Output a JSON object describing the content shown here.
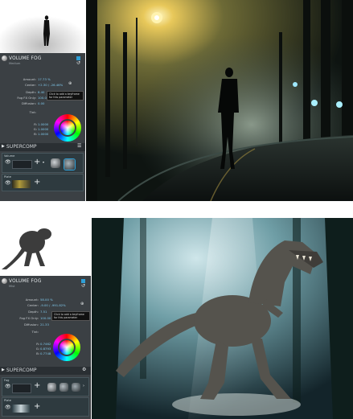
{
  "panel_top": {
    "plugin_title": "VOLUME FOG",
    "preset_label": "Medium",
    "amount_label": "Amount:",
    "amount_value": "17.73 %",
    "center_label": "Center:",
    "center_value": "+2.30 / -26.46%",
    "depth_label": "Depth:",
    "depth_value": "8.40",
    "fogfx_label": "Fog FX Only:",
    "fogfx_value": "100.0",
    "diffusion_label": "Diffusion:",
    "diffusion_value": "0.00",
    "tint_label": "Tint:",
    "tooltip": "Click to add a keyframe for this parameter",
    "r_label": "R:",
    "r_value": "1.0000",
    "g_label": "G:",
    "g_value": "1.0000",
    "b_label": "B:",
    "b_value": "1.0000",
    "supercomp_title": "SUPERCOMP",
    "layer_label": "Volume",
    "plate_label": "Plate",
    "plus_glyph": "+"
  },
  "panel_bottom": {
    "plugin_title": "VOLUME FOG",
    "preset_label": "Mist",
    "amount_label": "Amount:",
    "amount_value": "58.00 %",
    "center_label": "Center:",
    "center_value": "-9.00 / -991.82%",
    "depth_label": "Depth:",
    "depth_value": "7.51",
    "fogfx_label": "Fog FX Only:",
    "fogfx_value": "100.00",
    "diffusion_label": "Diffusion:",
    "diffusion_value": "21.33",
    "tint_label": "Tint:",
    "tooltip": "Click to add a keyframe for this parameter",
    "r_label": "R:",
    "r_value": "0.7462",
    "g_label": "G:",
    "g_value": "0.8793",
    "b_label": "B:",
    "b_value": "0.7748",
    "supercomp_title": "SUPERCOMP",
    "layer_label": "Fog",
    "plate_label": "Plate",
    "plus_glyph": "+"
  },
  "icons": {
    "eye": "👁",
    "reset": "↺",
    "gear": "⚙",
    "menu": "☰"
  },
  "colors": {
    "panel_bg": "#3b4044",
    "header_bg": "#2a2f33",
    "value_blue": "#7fc7ea",
    "accent_blue": "#2f9fd6"
  }
}
